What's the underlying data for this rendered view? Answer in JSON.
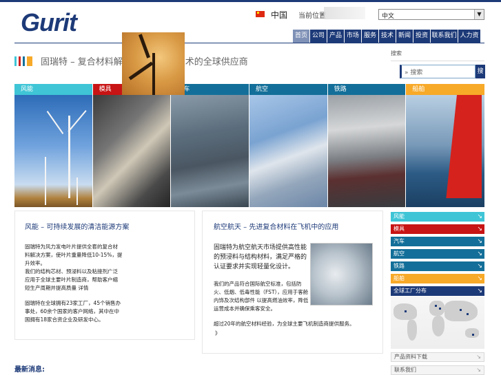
{
  "header": {
    "logo": "Gurit",
    "country": "中国",
    "location_label": "当前位置",
    "lang_select": "中文"
  },
  "nav": {
    "items": [
      {
        "label": "首页",
        "active": true
      },
      {
        "label": "公司"
      },
      {
        "label": "产品"
      },
      {
        "label": "市场"
      },
      {
        "label": "服务"
      },
      {
        "label": "技术"
      },
      {
        "label": "新闻"
      },
      {
        "label": "投资"
      },
      {
        "label": "联系我们"
      },
      {
        "label": "人力资源"
      }
    ]
  },
  "page": {
    "title": "固瑞特 – 复合材料解决方案与先进技术的全球供应商",
    "accent_colors": [
      "#3fc5d6",
      "#d21e1e",
      "#136f99",
      "#f7a928"
    ]
  },
  "search": {
    "label": "搜索",
    "placeholder": "» 搜索",
    "button": "搜索"
  },
  "banner": [
    {
      "title": "风能",
      "color": "#3fc5d6"
    },
    {
      "title": "模具",
      "color": "#c81414"
    },
    {
      "title": "汽车",
      "color": "#136f99"
    },
    {
      "title": "航空",
      "color": "#136f99"
    },
    {
      "title": "铁路",
      "color": "#136f99"
    },
    {
      "title": "船舶",
      "color": "#f7a928"
    }
  ],
  "card1": {
    "title": "风能 – 可持续发展的清洁能源方案",
    "para1": "固瑞特为风力发电叶片提供全套的复合材料解决方案，使叶片重量降低10-15%，提升效率。",
    "para2": "我们的结构芯材、预浸料以及粘接剂广泛应用于全球主要叶片制造商，帮助客户缩短生产周期并提高质量 详情",
    "para3": "固瑞特在全球拥有23家工厂，45个销售办事处，60余个国家的客户网络，其中在中国拥有18家合资企业及研发中心。"
  },
  "card2": {
    "title": "航空航天 – 先进复合材料在飞机中的应用",
    "para1": "固瑞特为航空航天市场提供高性能的预浸料与结构材料，满足严格的认证要求并实现轻量化设计。",
    "para2": "我们的产品符合国际航空标准，包括防火、低烟、低毒性能（FST），应用于客舱内饰及次结构部件 以提高燃油效率，降低运营成本并确保乘客安全。",
    "para3": "超过20年的航空材料经验，为全球主要飞机制造商提供服务。",
    "para3b": "》"
  },
  "sidebar_links": [
    {
      "label": "风能",
      "color": "#3fc5d6"
    },
    {
      "label": "模具",
      "color": "#c81414"
    },
    {
      "label": "汽车",
      "color": "#136f99"
    },
    {
      "label": "航空",
      "color": "#136f99"
    },
    {
      "label": "铁路",
      "color": "#136f99"
    },
    {
      "label": "船舶",
      "color": "#f7a928"
    },
    {
      "label": "全球工厂分布",
      "color": "#1d3a78"
    }
  ],
  "bottom_links": [
    {
      "label": "产品资料下载"
    },
    {
      "label": "联系我们"
    }
  ],
  "footer": {
    "label": "最新消息:"
  }
}
